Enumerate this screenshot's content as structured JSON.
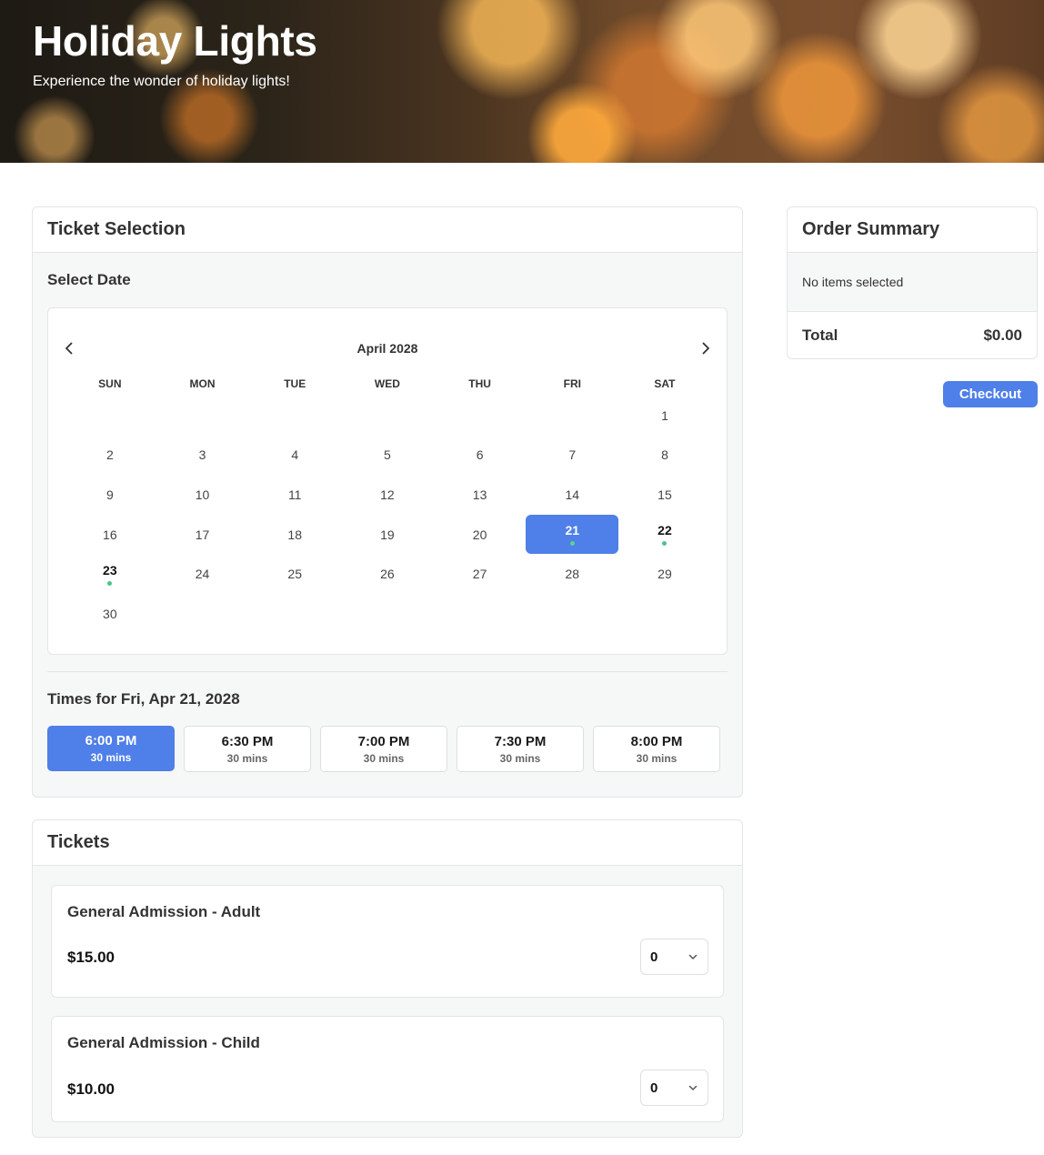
{
  "hero": {
    "title": "Holiday Lights",
    "subtitle": "Experience the wonder of holiday lights!"
  },
  "ticket_selection": {
    "heading": "Ticket Selection",
    "select_date_label": "Select Date",
    "calendar": {
      "month_label": "April 2028",
      "prev_icon": "chevron-left-icon",
      "next_icon": "chevron-right-icon",
      "weekdays": [
        "SUN",
        "MON",
        "TUE",
        "WED",
        "THU",
        "FRI",
        "SAT"
      ],
      "weeks": [
        [
          "",
          "",
          "",
          "",
          "",
          "",
          "1"
        ],
        [
          "2",
          "3",
          "4",
          "5",
          "6",
          "7",
          "8"
        ],
        [
          "9",
          "10",
          "11",
          "12",
          "13",
          "14",
          "15"
        ],
        [
          "16",
          "17",
          "18",
          "19",
          "20",
          "21",
          "22"
        ],
        [
          "23",
          "24",
          "25",
          "26",
          "27",
          "28",
          "29"
        ],
        [
          "30",
          "",
          "",
          "",
          "",
          "",
          ""
        ]
      ],
      "available_days": [
        "21",
        "22",
        "23"
      ],
      "selected_day": "21"
    },
    "times_label": "Times for Fri, Apr 21, 2028",
    "times": [
      {
        "time": "6:00 PM",
        "duration": "30 mins",
        "selected": true
      },
      {
        "time": "6:30 PM",
        "duration": "30 mins",
        "selected": false
      },
      {
        "time": "7:00 PM",
        "duration": "30 mins",
        "selected": false
      },
      {
        "time": "7:30 PM",
        "duration": "30 mins",
        "selected": false
      },
      {
        "time": "8:00 PM",
        "duration": "30 mins",
        "selected": false
      }
    ]
  },
  "tickets": {
    "heading": "Tickets",
    "items": [
      {
        "name": "General Admission - Adult",
        "price": "$15.00",
        "quantity": "0"
      },
      {
        "name": "General Admission - Child",
        "price": "$10.00",
        "quantity": "0"
      }
    ]
  },
  "order_summary": {
    "heading": "Order Summary",
    "empty_text": "No items selected",
    "total_label": "Total",
    "total_value": "$0.00",
    "checkout_label": "Checkout"
  },
  "colors": {
    "accent": "#4f7fe8",
    "availability_dot": "#4cc38a"
  }
}
